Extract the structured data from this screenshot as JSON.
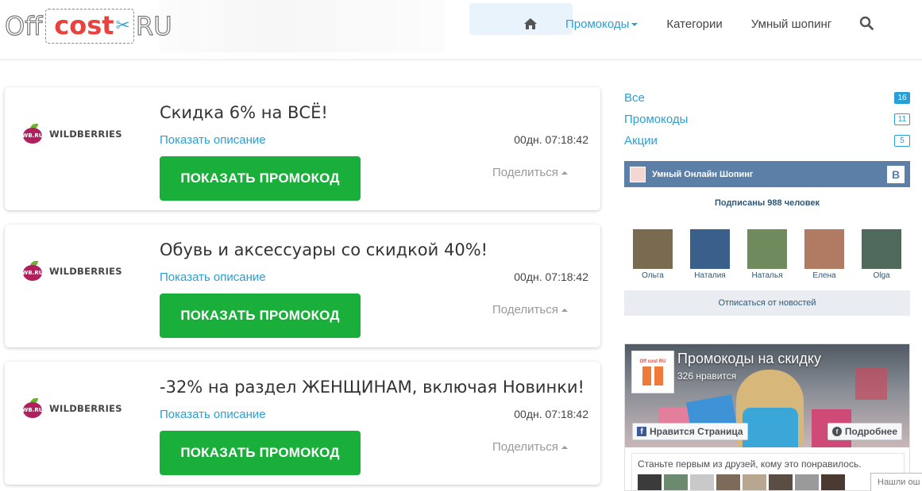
{
  "header": {
    "logo": {
      "off": "Off",
      "cost": "cost",
      "ru": "RU"
    },
    "nav": [
      {
        "label": "Промокоды",
        "active": true
      },
      {
        "label": "Категории",
        "active": false
      },
      {
        "label": "Умный шопинг",
        "active": false
      }
    ]
  },
  "coupons": [
    {
      "brand": "WILDBERRIES",
      "brand_badge": "WB.RU",
      "title": "Скидка 6% на ВСЁ!",
      "description_link": "Показать описание",
      "timer": "00дн. 07:18:42",
      "button": "ПОКАЗАТЬ ПРОМОКОД",
      "share": "Поделиться"
    },
    {
      "brand": "WILDBERRIES",
      "brand_badge": "WB.RU",
      "title": "Обувь и аксессуары со скидкой 40%!",
      "description_link": "Показать описание",
      "timer": "00дн. 07:18:42",
      "button": "ПОКАЗАТЬ ПРОМОКОД",
      "share": "Поделиться"
    },
    {
      "brand": "WILDBERRIES",
      "brand_badge": "WB.RU",
      "title": "-32% на раздел ЖЕНЩИНАМ, включая Новинки!",
      "description_link": "Показать описание",
      "timer": "00дн. 07:18:42",
      "button": "ПОКАЗАТЬ ПРОМОКОД",
      "share": "Поделиться"
    }
  ],
  "categories": [
    {
      "label": "Все",
      "count": "16",
      "filled": true
    },
    {
      "label": "Промокоды",
      "count": "11",
      "filled": false
    },
    {
      "label": "Акции",
      "count": "5",
      "filled": false
    }
  ],
  "vk": {
    "title": "Умный Онлайн Шопинг",
    "vk_letter": "B",
    "subscribers": "Подписаны 988 человек",
    "people": [
      {
        "name": "Ольга",
        "color": "#7a6a4f"
      },
      {
        "name": "Наталия",
        "color": "#3a5f8a"
      },
      {
        "name": "Наталья",
        "color": "#6f8b5d"
      },
      {
        "name": "Елена",
        "color": "#b07a63"
      },
      {
        "name": "Olga",
        "color": "#4f6a5a"
      }
    ],
    "unsubscribe": "Отписаться от новостей"
  },
  "fb": {
    "logo_text": "Off cost RU",
    "page_name": "Промокоды на скидку",
    "likes": "326 нравится",
    "like_button": "Нравится Страница",
    "more_button": "Подробнее",
    "friends_text": "Станьте первым из друзей, кому это понравилось.",
    "faces": [
      "#3b3b3b",
      "#6b8a6e",
      "#c9c9c9",
      "#7d6a58",
      "#b9a690",
      "#5a4d44",
      "#9a9a9a",
      "#4a3a32"
    ]
  },
  "found_popup": "Нашли ош",
  "colors": {
    "accent": "#2a9fd6",
    "button_green": "#1aaf3a",
    "vk_blue": "#5b7fa6"
  }
}
